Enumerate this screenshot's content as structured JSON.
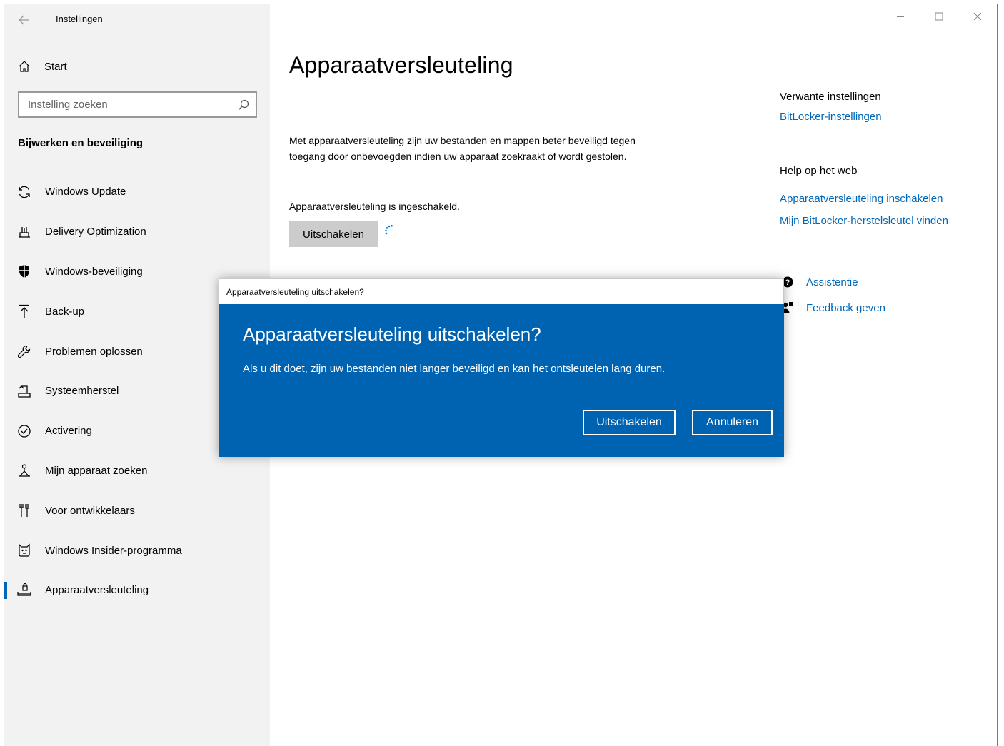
{
  "window": {
    "app_title": "Instellingen",
    "controls": {
      "minimize": "—",
      "maximize": "☐",
      "close": "✕"
    }
  },
  "sidebar": {
    "home_label": "Start",
    "search_placeholder": "Instelling zoeken",
    "section_title": "Bijwerken en beveiliging",
    "items": [
      {
        "label": "Windows Update",
        "icon": "sync-icon"
      },
      {
        "label": "Delivery Optimization",
        "icon": "delivery-optimization-icon"
      },
      {
        "label": "Windows-beveiliging",
        "icon": "shield-icon"
      },
      {
        "label": "Back-up",
        "icon": "backup-upload-icon"
      },
      {
        "label": "Problemen oplossen",
        "icon": "wrench-icon"
      },
      {
        "label": "Systeemherstel",
        "icon": "recovery-icon"
      },
      {
        "label": "Activering",
        "icon": "check-circle-icon"
      },
      {
        "label": "Mijn apparaat zoeken",
        "icon": "find-device-icon"
      },
      {
        "label": "Voor ontwikkelaars",
        "icon": "developer-tools-icon"
      },
      {
        "label": "Windows Insider-programma",
        "icon": "insider-cat-icon"
      },
      {
        "label": "Apparaatversleuteling",
        "icon": "device-encryption-icon",
        "selected": true
      }
    ],
    "accent_color": "#0067b8"
  },
  "main": {
    "title": "Apparaatversleuteling",
    "description": "Met apparaatversleuteling zijn uw bestanden en mappen beter beveiligd tegen toegang door onbevoegden indien uw apparaat zoekraakt of wordt gestolen.",
    "status": "Apparaatversleuteling is ingeschakeld.",
    "disable_button": "Uitschakelen"
  },
  "related": {
    "heading": "Verwante instellingen",
    "bitlocker_link": "BitLocker-instellingen",
    "help_heading": "Help op het web",
    "help_links": [
      "Apparaatversleuteling inschakelen",
      "Mijn BitLocker-herstelsleutel vinden"
    ],
    "assist_label": "Assistentie",
    "feedback_label": "Feedback geven"
  },
  "dialog": {
    "window_title": "Apparaatversleuteling uitschakelen?",
    "heading": "Apparaatversleuteling uitschakelen?",
    "message": "Als u dit doet, zijn uw bestanden niet langer beveiligd en kan het ontsleutelen lang duren.",
    "confirm_button": "Uitschakelen",
    "cancel_button": "Annuleren",
    "background_color": "#0063b1"
  }
}
